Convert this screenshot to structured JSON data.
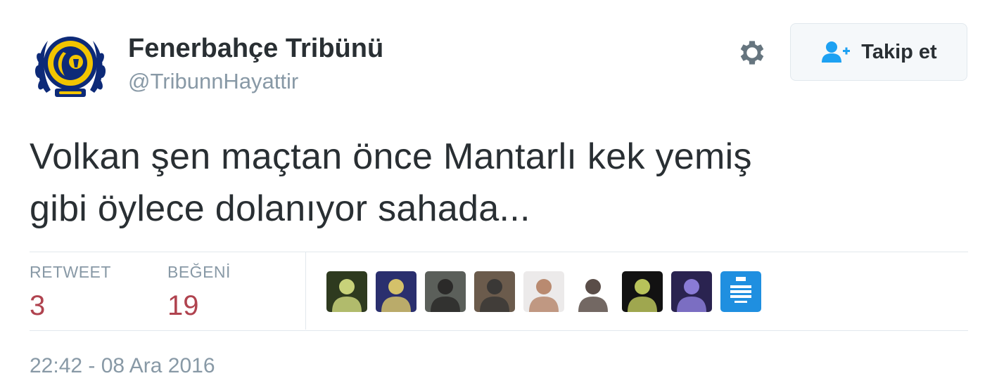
{
  "user": {
    "name": "Fenerbahçe Tribünü",
    "handle": "@TribunnHayattir",
    "avatar_icon": "fenerbahce-crest-icon",
    "avatar_colors": [
      "#0d2a78",
      "#f2c500"
    ]
  },
  "actions": {
    "settings_icon": "gear-icon",
    "follow_icon": "add-user-icon",
    "follow_label": "Takip et"
  },
  "tweet": {
    "text_line1": "Volkan şen maçtan önce Mantarlı kek yemiş",
    "text_line2": "gibi öylece dolanıyor sahada..."
  },
  "stats": {
    "retweet_label": "RETWEET",
    "retweet_count": "3",
    "like_label": "BEĞENİ",
    "like_count": "19"
  },
  "likers": [
    {
      "icon": "liker-avatar-icon",
      "colors": [
        "#2e3a1f",
        "#c8d27a"
      ]
    },
    {
      "icon": "liker-avatar-icon",
      "colors": [
        "#2a2f6e",
        "#d4c16a"
      ]
    },
    {
      "icon": "liker-avatar-icon",
      "colors": [
        "#5b5f5a",
        "#2b2a29"
      ]
    },
    {
      "icon": "liker-avatar-icon",
      "colors": [
        "#6b5b4c",
        "#3a3836"
      ]
    },
    {
      "icon": "liker-avatar-icon",
      "colors": [
        "#eceaea",
        "#b98a70"
      ]
    },
    {
      "icon": "liker-avatar-icon",
      "colors": [
        "#ffffff",
        "#5a4d48"
      ]
    },
    {
      "icon": "liker-avatar-icon",
      "colors": [
        "#121212",
        "#b8c25a"
      ]
    },
    {
      "icon": "liker-avatar-icon",
      "colors": [
        "#2a2350",
        "#8a7bd6"
      ]
    },
    {
      "icon": "keep-calm-avatar-icon",
      "colors": [
        "#1f8fe0",
        "#ffffff"
      ]
    }
  ],
  "meta": {
    "timestamp": "22:42 - 08 Ara 2016"
  },
  "colors": {
    "text": "#292f33",
    "muted": "#8899a6",
    "count": "#b0434f",
    "follow_icon": "#1da1f2"
  }
}
